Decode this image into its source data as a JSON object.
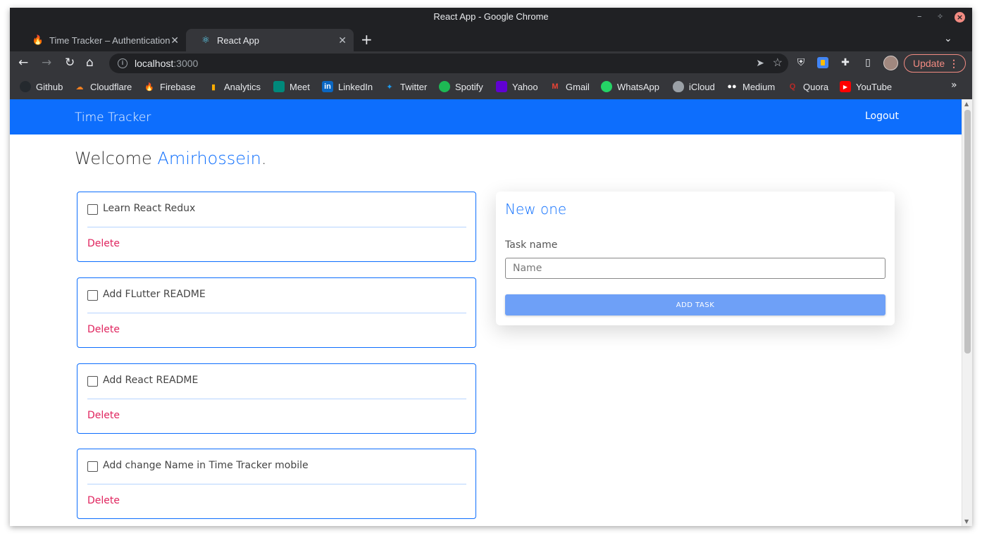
{
  "window": {
    "title": "React App - Google Chrome"
  },
  "tabs": [
    {
      "title": "Time Tracker – Authentication",
      "icon": "firebase-icon"
    },
    {
      "title": "React App",
      "icon": "react-icon"
    }
  ],
  "toolbar": {
    "url_host": "localhost",
    "url_port": ":3000",
    "update_label": "Update"
  },
  "bookmarks": [
    {
      "label": "Github",
      "icon": "github-icon",
      "color": "#24292e"
    },
    {
      "label": "Cloudflare",
      "icon": "cloudflare-icon",
      "color": "#f38020"
    },
    {
      "label": "Firebase",
      "icon": "firebase-icon",
      "color": "#ffca28"
    },
    {
      "label": "Analytics",
      "icon": "analytics-icon",
      "color": "#f9ab00"
    },
    {
      "label": "Meet",
      "icon": "meet-icon",
      "color": "#00897b"
    },
    {
      "label": "LinkedIn",
      "icon": "linkedin-icon",
      "color": "#0a66c2"
    },
    {
      "label": "Twitter",
      "icon": "twitter-icon",
      "color": "#1d9bf0"
    },
    {
      "label": "Spotify",
      "icon": "spotify-icon",
      "color": "#1db954"
    },
    {
      "label": "Yahoo",
      "icon": "yahoo-icon",
      "color": "#6001d2"
    },
    {
      "label": "Gmail",
      "icon": "gmail-icon",
      "color": "#ea4335"
    },
    {
      "label": "WhatsApp",
      "icon": "whatsapp-icon",
      "color": "#25d366"
    },
    {
      "label": "iCloud",
      "icon": "apple-icon",
      "color": "#9aa0a6"
    },
    {
      "label": "Medium",
      "icon": "medium-icon",
      "color": "#000000"
    },
    {
      "label": "Quora",
      "icon": "quora-icon",
      "color": "#b92b27"
    },
    {
      "label": "YouTube",
      "icon": "youtube-icon",
      "color": "#ff0000"
    }
  ],
  "app": {
    "brand": "Time Tracker",
    "logout": "Logout",
    "welcome_prefix": "Welcome ",
    "username": "Amirhossein",
    "welcome_suffix": ".",
    "accent": "#0d6efd",
    "delete_color": "#e0245e"
  },
  "tasks": [
    {
      "name": "Learn React Redux",
      "done": false,
      "delete_label": "Delete"
    },
    {
      "name": "Add FLutter README",
      "done": false,
      "delete_label": "Delete"
    },
    {
      "name": "Add React README",
      "done": false,
      "delete_label": "Delete"
    },
    {
      "name": "Add change Name in Time Tracker mobile",
      "done": false,
      "delete_label": "Delete"
    }
  ],
  "new_task_form": {
    "title": "New one",
    "label": "Task name",
    "placeholder": "Name",
    "value": "",
    "button_label": "ADD TASK"
  }
}
